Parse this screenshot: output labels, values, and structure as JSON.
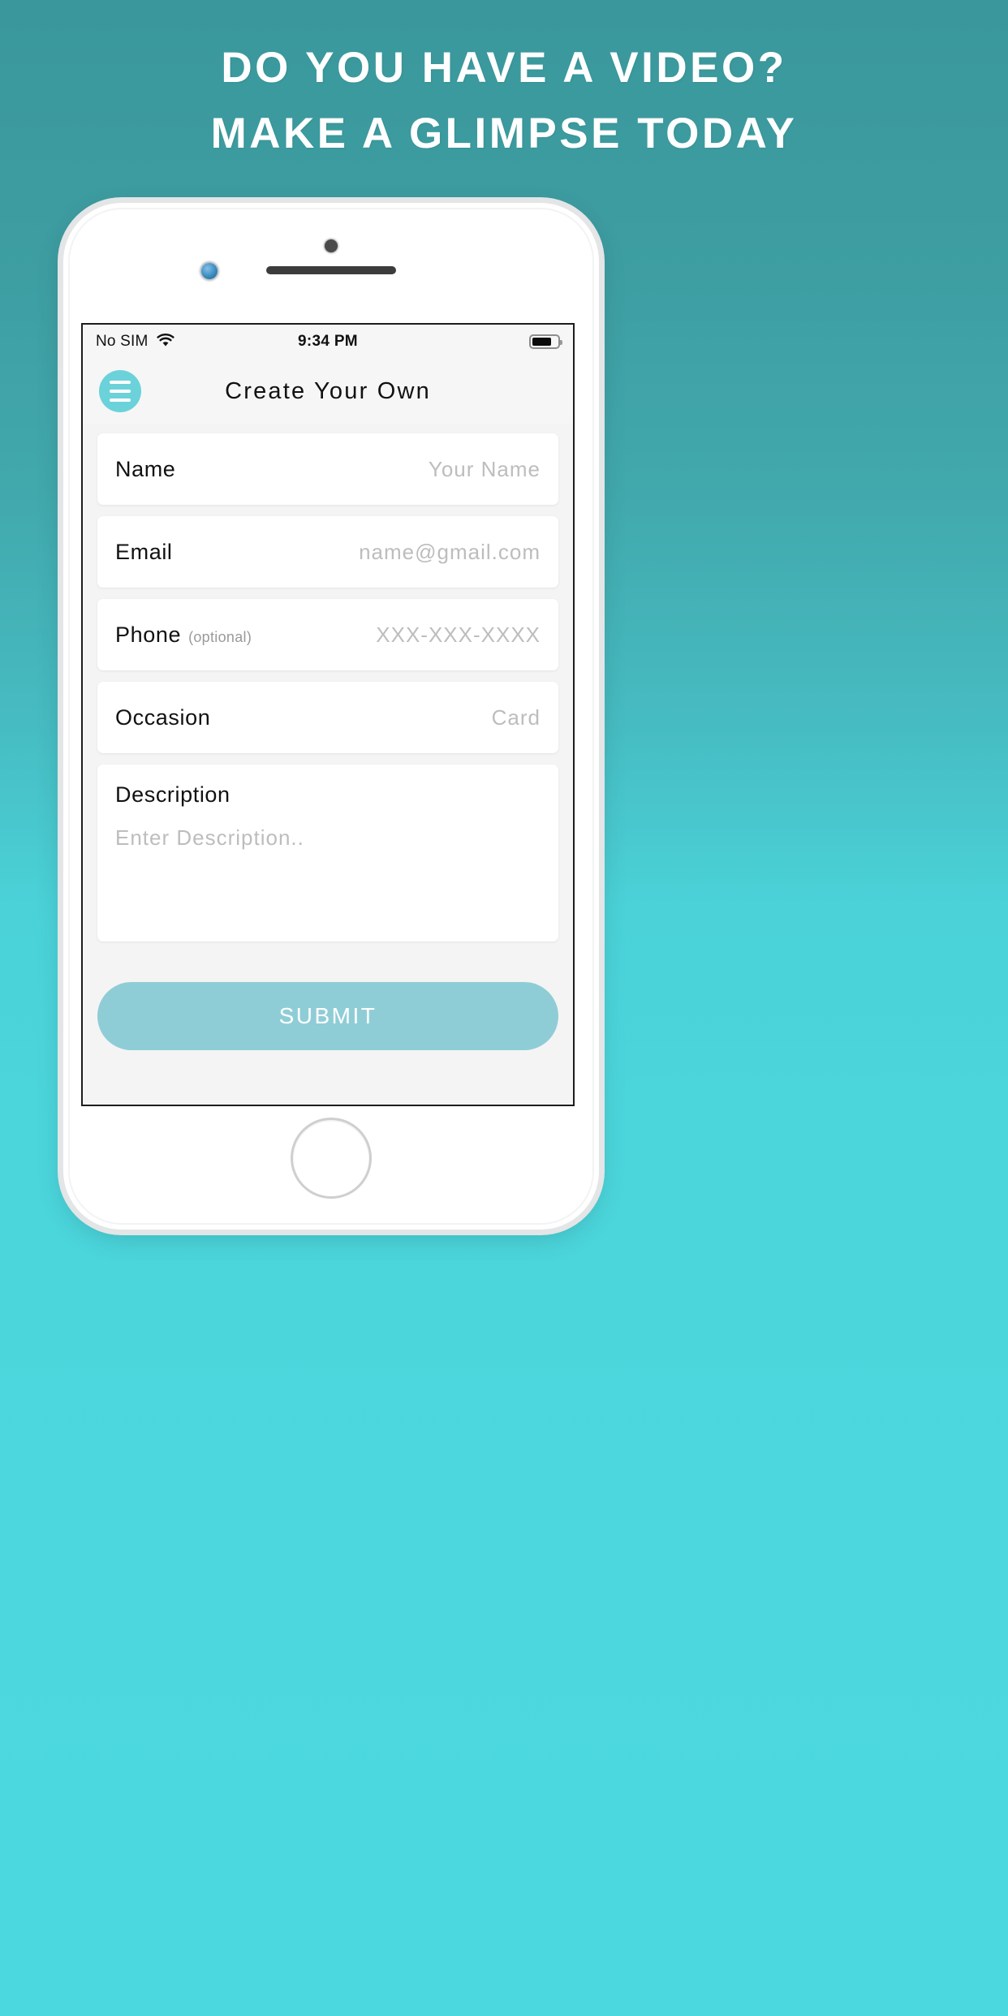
{
  "promo": {
    "headline_lines": [
      "DO YOU HAVE A VIDEO?",
      "MAKE A GLIMPSE TODAY"
    ]
  },
  "colors": {
    "background_top": "#3a989c",
    "background_bottom": "#4bd8de",
    "accent_teal": "#6bd2da",
    "submit_button": "#8fcdd6"
  },
  "phone": {
    "status_bar": {
      "carrier": "No SIM",
      "wifi_icon": "wifi-icon",
      "time": "9:34 PM",
      "battery_icon": "battery-icon"
    },
    "nav_bar": {
      "menu_icon": "hamburger-menu-icon",
      "title": "Create Your Own"
    },
    "form": {
      "fields": [
        {
          "label": "Name",
          "suffix": "",
          "value": "",
          "placeholder": "Your Name"
        },
        {
          "label": "Email",
          "suffix": "",
          "value": "",
          "placeholder": "name@gmail.com"
        },
        {
          "label": "Phone",
          "suffix": "(optional)",
          "value": "",
          "placeholder": "XXX-XXX-XXXX"
        },
        {
          "label": "Occasion",
          "suffix": "",
          "value": "",
          "placeholder": "Card"
        }
      ],
      "description": {
        "label": "Description",
        "value": "",
        "placeholder": "Enter Description.."
      },
      "submit_label": "SUBMIT"
    },
    "home_button": "home-button"
  }
}
